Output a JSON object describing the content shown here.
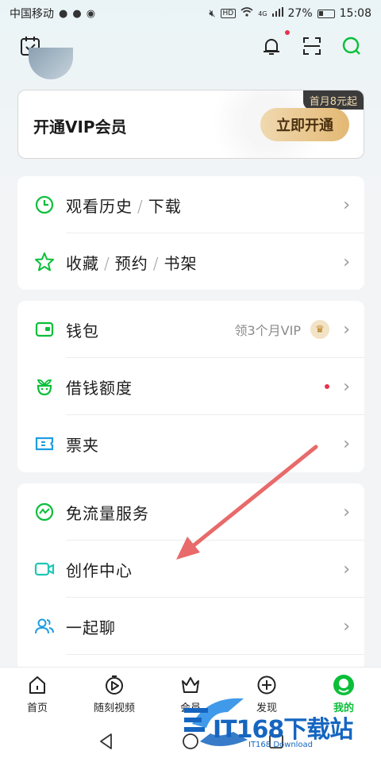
{
  "status_bar": {
    "carrier": "中国移动",
    "battery": "27%",
    "time": "15:08",
    "network": "4G",
    "hd": "HD"
  },
  "top_bar": {
    "icons": [
      "calendar-check-icon",
      "bell-icon",
      "scan-icon",
      "search-icon"
    ]
  },
  "vip": {
    "title": "开通VIP会员",
    "badge": "首月8元起",
    "button": "立即开通"
  },
  "menu": {
    "card1": {
      "history": {
        "label_a": "观看历史",
        "label_b": "下载"
      },
      "favorites": {
        "label_a": "收藏",
        "label_b": "预约",
        "label_c": "书架"
      }
    },
    "card2": {
      "wallet": {
        "label": "钱包",
        "extra": "领3个月VIP"
      },
      "loan": {
        "label": "借钱额度"
      },
      "tickets": {
        "label": "票夹"
      }
    },
    "card3": {
      "free_data": {
        "label": "免流量服务"
      },
      "creator": {
        "label": "创作中心"
      },
      "chat": {
        "label": "一起聊"
      }
    },
    "separator": "/"
  },
  "bottom_nav": [
    {
      "label": "首页"
    },
    {
      "label": "随刻视频"
    },
    {
      "label": "会员"
    },
    {
      "label": "发现"
    },
    {
      "label": "我的"
    }
  ],
  "watermark": {
    "text": "IT168下载站",
    "sub": "IT168 Download"
  },
  "colors": {
    "accent": "#0bbf39",
    "vip_gold": "#e3b873",
    "badge_dark": "#3b3b3b",
    "alert_red": "#e8324d",
    "annotation_arrow": "#e86a6a"
  }
}
